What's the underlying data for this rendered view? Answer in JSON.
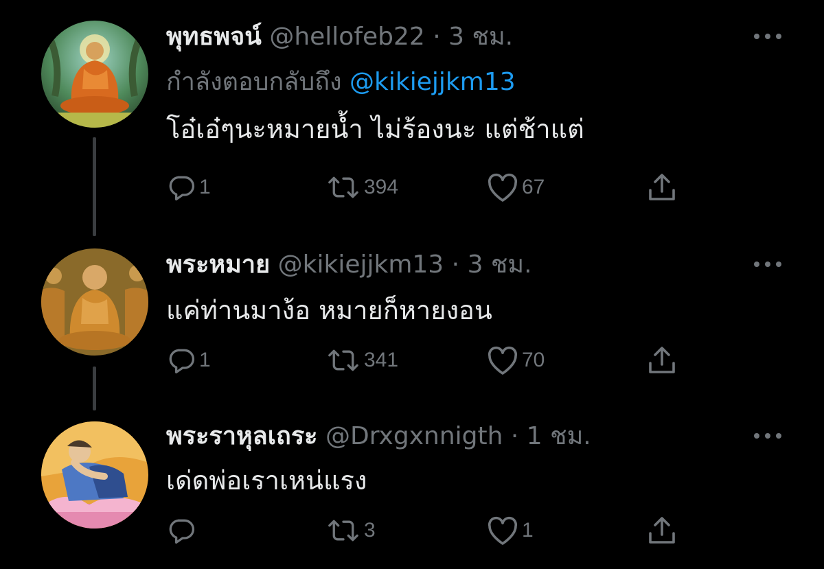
{
  "tweets": [
    {
      "display_name": "พุทธพจน์",
      "handle": "@hellofeb22",
      "separator": "·",
      "time": "3 ชม.",
      "replying_prefix": "กำลังตอบกลับถึง",
      "replying_to": "@kikiejjkm13",
      "text": "โอ๋เอ๋ๆนะหมายน้ำ ไม่ร้องนะ แต่ช้าแต่",
      "replies": "1",
      "retweets": "394",
      "likes": "67",
      "avatar_icon": "meditating-buddha-avatar"
    },
    {
      "display_name": "พระหมาย",
      "handle": "@kikiejjkm13",
      "separator": "·",
      "time": "3 ชม.",
      "text": "แค่ท่านมาง้อ หมายก็หายงอน",
      "replies": "1",
      "retweets": "341",
      "likes": "70",
      "avatar_icon": "seated-monks-avatar"
    },
    {
      "display_name": "พระราหุลเถระ",
      "handle": "@Drxgxnnigth",
      "separator": "·",
      "time": "1 ชม.",
      "text": "เด่ดพ่อเราเหน่แรง",
      "replies": "",
      "retweets": "3",
      "likes": "1",
      "avatar_icon": "embrace-painting-avatar"
    }
  ],
  "colors": {
    "background": "#000000",
    "primary_text": "#e7e9ea",
    "secondary_text": "#71767b",
    "mention": "#1d9bf0",
    "thread_line": "#3a3d40"
  }
}
